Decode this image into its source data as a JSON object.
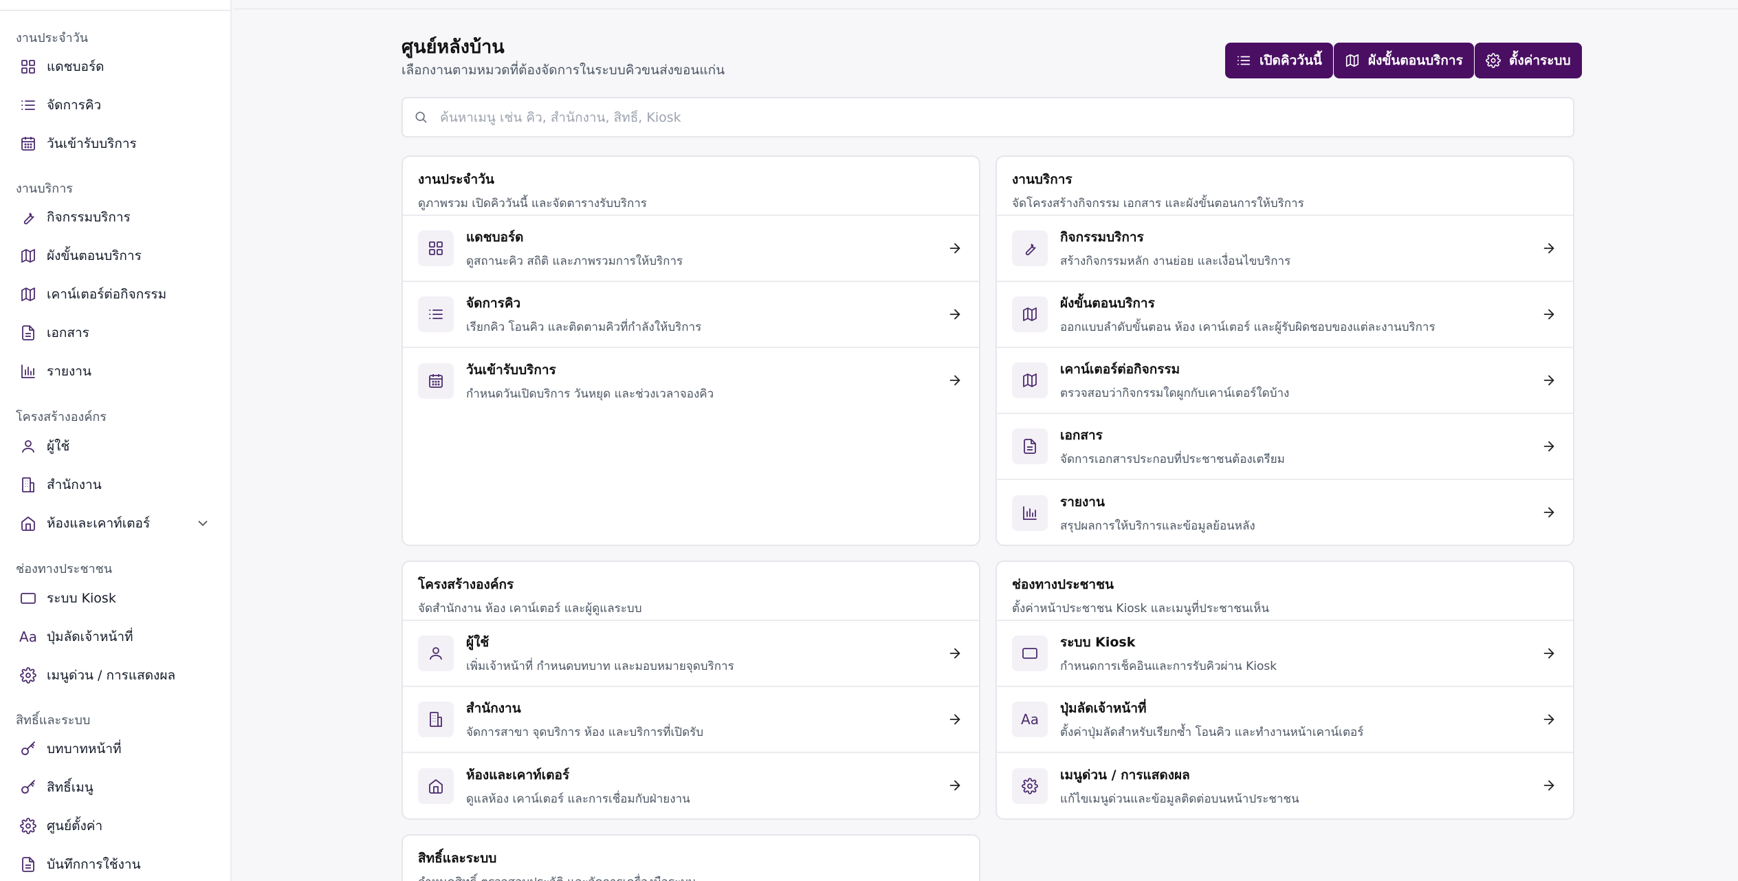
{
  "sidebar": {
    "groups": [
      {
        "title": "งานประจำวัน",
        "items": [
          {
            "label": "แดชบอร์ด",
            "icon": "grid-icon"
          },
          {
            "label": "จัดการคิว",
            "icon": "list-icon"
          },
          {
            "label": "วันเข้ารับบริการ",
            "icon": "calendar-icon"
          }
        ]
      },
      {
        "title": "งานบริการ",
        "items": [
          {
            "label": "กิจกรรมบริการ",
            "icon": "wrench-icon"
          },
          {
            "label": "ผังขั้นตอนบริการ",
            "icon": "map-icon"
          },
          {
            "label": "เคาน์เตอร์ต่อกิจกรรม",
            "icon": "map-icon"
          },
          {
            "label": "เอกสาร",
            "icon": "document-icon"
          },
          {
            "label": "รายงาน",
            "icon": "bar-chart-icon"
          }
        ]
      },
      {
        "title": "โครงสร้างองค์กร",
        "items": [
          {
            "label": "ผู้ใช้",
            "icon": "user-icon"
          },
          {
            "label": "สำนักงาน",
            "icon": "building-icon"
          },
          {
            "label": "ห้องและเคาท์เตอร์",
            "icon": "home-icon"
          }
        ]
      },
      {
        "title": "ช่องทางประชาชน",
        "items": [
          {
            "label": "ระบบ Kiosk",
            "icon": "monitor-icon"
          },
          {
            "label": "ปุ่มลัดเจ้าหน้าที่",
            "icon": "text-aa-icon"
          },
          {
            "label": "เมนูด่วน / การแสดงผล",
            "icon": "gear-icon"
          }
        ]
      },
      {
        "title": "สิทธิ์และระบบ",
        "items": [
          {
            "label": "บทบาทหน้าที่",
            "icon": "key-icon"
          },
          {
            "label": "สิทธิ์เมนู",
            "icon": "key-icon"
          },
          {
            "label": "ศูนย์ตั้งค่า",
            "icon": "gear-icon"
          },
          {
            "label": "บันทึกการใช้งาน",
            "icon": "document-icon"
          }
        ]
      }
    ]
  },
  "header": {
    "title": "ศูนย์หลังบ้าน",
    "subtitle": "เลือกงานตามหมวดที่ต้องจัดการในระบบคิวขนส่งขอนแก่น",
    "buttons": [
      {
        "label": "เปิดคิววันนี้",
        "icon": "list-icon"
      },
      {
        "label": "ผังขั้นตอนบริการ",
        "icon": "map-icon"
      },
      {
        "label": "ตั้งค่าระบบ",
        "icon": "gear-icon"
      }
    ]
  },
  "search": {
    "placeholder": "ค้นหาเมนู เช่น คิว, สำนักงาน, สิทธิ์, Kiosk",
    "value": ""
  },
  "cards": [
    {
      "title": "งานประจำวัน",
      "subtitle": "ดูภาพรวม เปิดคิววันนี้ และจัดตารางรับบริการ",
      "rows": [
        {
          "title": "แดชบอร์ด",
          "desc": "ดูสถานะคิว สถิติ และภาพรวมการให้บริการ",
          "icon": "grid-icon"
        },
        {
          "title": "จัดการคิว",
          "desc": "เรียกคิว โอนคิว และติดตามคิวที่กำลังให้บริการ",
          "icon": "list-icon"
        },
        {
          "title": "วันเข้ารับบริการ",
          "desc": "กำหนดวันเปิดบริการ วันหยุด และช่วงเวลาจองคิว",
          "icon": "calendar-icon"
        }
      ]
    },
    {
      "title": "งานบริการ",
      "subtitle": "จัดโครงสร้างกิจกรรม เอกสาร และผังขั้นตอนการให้บริการ",
      "rows": [
        {
          "title": "กิจกรรมบริการ",
          "desc": "สร้างกิจกรรมหลัก งานย่อย และเงื่อนไขบริการ",
          "icon": "wrench-icon"
        },
        {
          "title": "ผังขั้นตอนบริการ",
          "desc": "ออกแบบลำดับขั้นตอน ห้อง เคาน์เตอร์ และผู้รับผิดชอบของแต่ละงานบริการ",
          "icon": "map-icon"
        },
        {
          "title": "เคาน์เตอร์ต่อกิจกรรม",
          "desc": "ตรวจสอบว่ากิจกรรมใดผูกกับเคาน์เตอร์ใดบ้าง",
          "icon": "map-icon"
        },
        {
          "title": "เอกสาร",
          "desc": "จัดการเอกสารประกอบที่ประชาชนต้องเตรียม",
          "icon": "document-icon"
        },
        {
          "title": "รายงาน",
          "desc": "สรุปผลการให้บริการและข้อมูลย้อนหลัง",
          "icon": "bar-chart-icon"
        }
      ]
    },
    {
      "title": "โครงสร้างองค์กร",
      "subtitle": "จัดสำนักงาน ห้อง เคาน์เตอร์ และผู้ดูแลระบบ",
      "rows": [
        {
          "title": "ผู้ใช้",
          "desc": "เพิ่มเจ้าหน้าที่ กำหนดบทบาท และมอบหมายจุดบริการ",
          "icon": "user-icon"
        },
        {
          "title": "สำนักงาน",
          "desc": "จัดการสาขา จุดบริการ ห้อง และบริการที่เปิดรับ",
          "icon": "building-icon"
        },
        {
          "title": "ห้องและเคาท์เตอร์",
          "desc": "ดูแลห้อง เคาน์เตอร์ และการเชื่อมกับฝ่ายงาน",
          "icon": "home-icon"
        }
      ]
    },
    {
      "title": "ช่องทางประชาชน",
      "subtitle": "ตั้งค่าหน้าประชาชน Kiosk และเมนูที่ประชาชนเห็น",
      "rows": [
        {
          "title": "ระบบ Kiosk",
          "desc": "กำหนดการเช็คอินและการรับคิวผ่าน Kiosk",
          "icon": "monitor-icon"
        },
        {
          "title": "ปุ่มลัดเจ้าหน้าที่",
          "desc": "ตั้งค่าปุ่มลัดสำหรับเรียกซ้ำ โอนคิว และทำงานหน้าเคาน์เตอร์",
          "icon": "text-aa-icon"
        },
        {
          "title": "เมนูด่วน / การแสดงผล",
          "desc": "แก้ไขเมนูด่วนและข้อมูลติดต่อบนหน้าประชาชน",
          "icon": "gear-icon"
        }
      ]
    },
    {
      "title": "สิทธิ์และระบบ",
      "subtitle": "กำหนดสิทธิ์ ตรวจสอบประวัติ และจัดการเครื่องมือระบบ",
      "rows": []
    }
  ],
  "icons": {
    "aa_text": "Aa"
  },
  "colors": {
    "accent": "#4a0f63",
    "icon": "#4b2a6e"
  }
}
